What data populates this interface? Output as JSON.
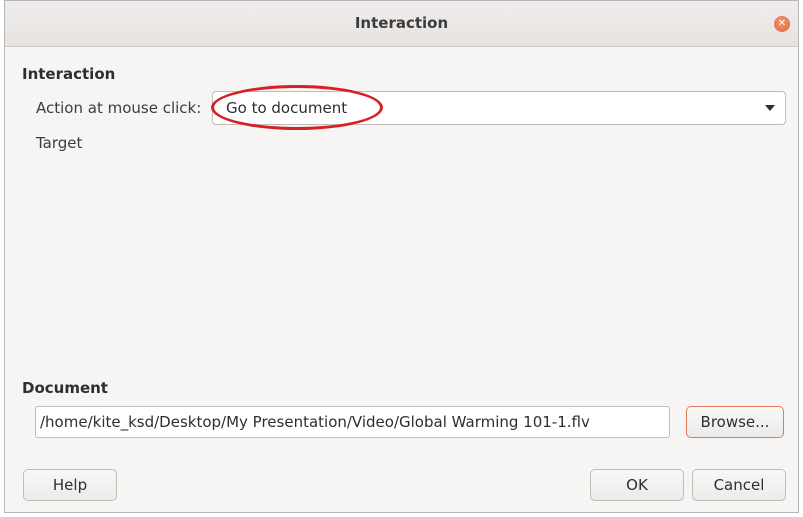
{
  "dialog": {
    "title": "Interaction",
    "close_icon": "close-icon",
    "close_color": "#e0663b"
  },
  "interaction": {
    "heading": "Interaction",
    "action_label": "Action at mouse click:",
    "action_value": "Go to document",
    "target_label": "Target"
  },
  "document": {
    "heading": "Document",
    "path": "/home/kite_ksd/Desktop/My Presentation/Video/Global Warming 101-1.flv",
    "browse_label": "Browse..."
  },
  "buttons": {
    "help": "Help",
    "ok": "OK",
    "cancel": "Cancel"
  },
  "annotation": {
    "highlight_color": "#d71f24"
  }
}
